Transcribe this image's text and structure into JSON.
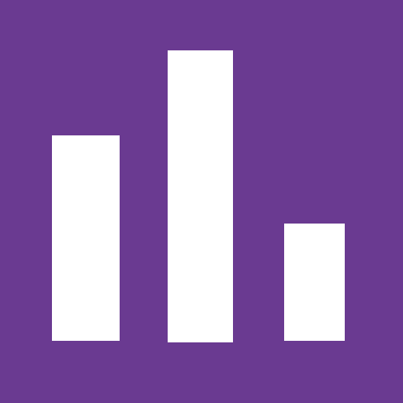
{
  "icon": {
    "name": "bar-chart-icon",
    "background_color": "#6a3a91",
    "bar_color": "#ffffff",
    "relative_bar_levels": [
      0.7,
      1.0,
      0.4
    ]
  }
}
